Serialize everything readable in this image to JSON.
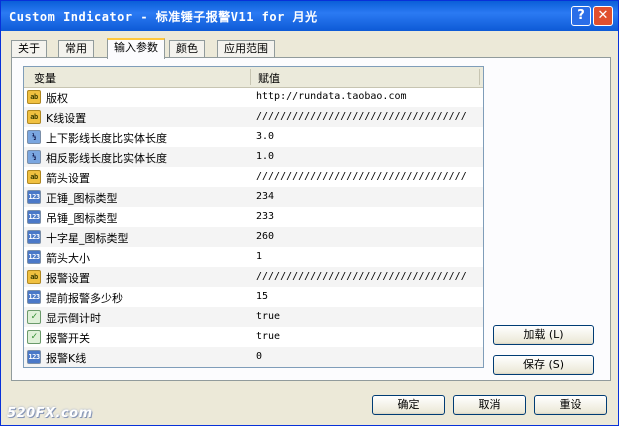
{
  "window": {
    "title": "Custom Indicator - 标准锤子报警V11 for 月光",
    "help_label": "?",
    "close_label": "✕"
  },
  "tabs": [
    {
      "label": "关于"
    },
    {
      "label": "常用"
    },
    {
      "label": "输入参数",
      "active": true
    },
    {
      "label": "颜色"
    },
    {
      "label": "应用范围"
    }
  ],
  "grid": {
    "col_variable": "变量",
    "col_value": "赋值",
    "rows": [
      {
        "icon": "string-icon",
        "icon_text": "ab",
        "name": "版权",
        "value": "http://rundata.taobao.com"
      },
      {
        "icon": "string-icon",
        "icon_text": "ab",
        "name": "K线设置",
        "value": "///////////////////////////////////"
      },
      {
        "icon": "double-icon",
        "icon_text": "½",
        "name": "上下影线长度比实体长度",
        "value": "3.0"
      },
      {
        "icon": "double-icon",
        "icon_text": "½",
        "name": "相反影线长度比实体长度",
        "value": "1.0"
      },
      {
        "icon": "string-icon",
        "icon_text": "ab",
        "name": "箭头设置",
        "value": "///////////////////////////////////"
      },
      {
        "icon": "integer-icon",
        "icon_text": "123",
        "name": "正锤_图标类型",
        "value": "234"
      },
      {
        "icon": "integer-icon",
        "icon_text": "123",
        "name": "吊锤_图标类型",
        "value": "233"
      },
      {
        "icon": "integer-icon",
        "icon_text": "123",
        "name": "十字星_图标类型",
        "value": "260"
      },
      {
        "icon": "integer-icon",
        "icon_text": "123",
        "name": "箭头大小",
        "value": "1"
      },
      {
        "icon": "string-icon",
        "icon_text": "ab",
        "name": "报警设置",
        "value": "///////////////////////////////////"
      },
      {
        "icon": "integer-icon",
        "icon_text": "123",
        "name": "提前报警多少秒",
        "value": "15"
      },
      {
        "icon": "bool-icon",
        "icon_text": "✓",
        "name": "显示倒计时",
        "value": "true"
      },
      {
        "icon": "bool-icon",
        "icon_text": "✓",
        "name": "报警开关",
        "value": "true"
      },
      {
        "icon": "integer-icon",
        "icon_text": "123",
        "name": "报警K线",
        "value": "0"
      }
    ]
  },
  "buttons": {
    "load": "加载 (L)",
    "save": "保存 (S)",
    "ok": "确定",
    "cancel": "取消",
    "reset": "重设"
  },
  "watermark": "520FX.com"
}
